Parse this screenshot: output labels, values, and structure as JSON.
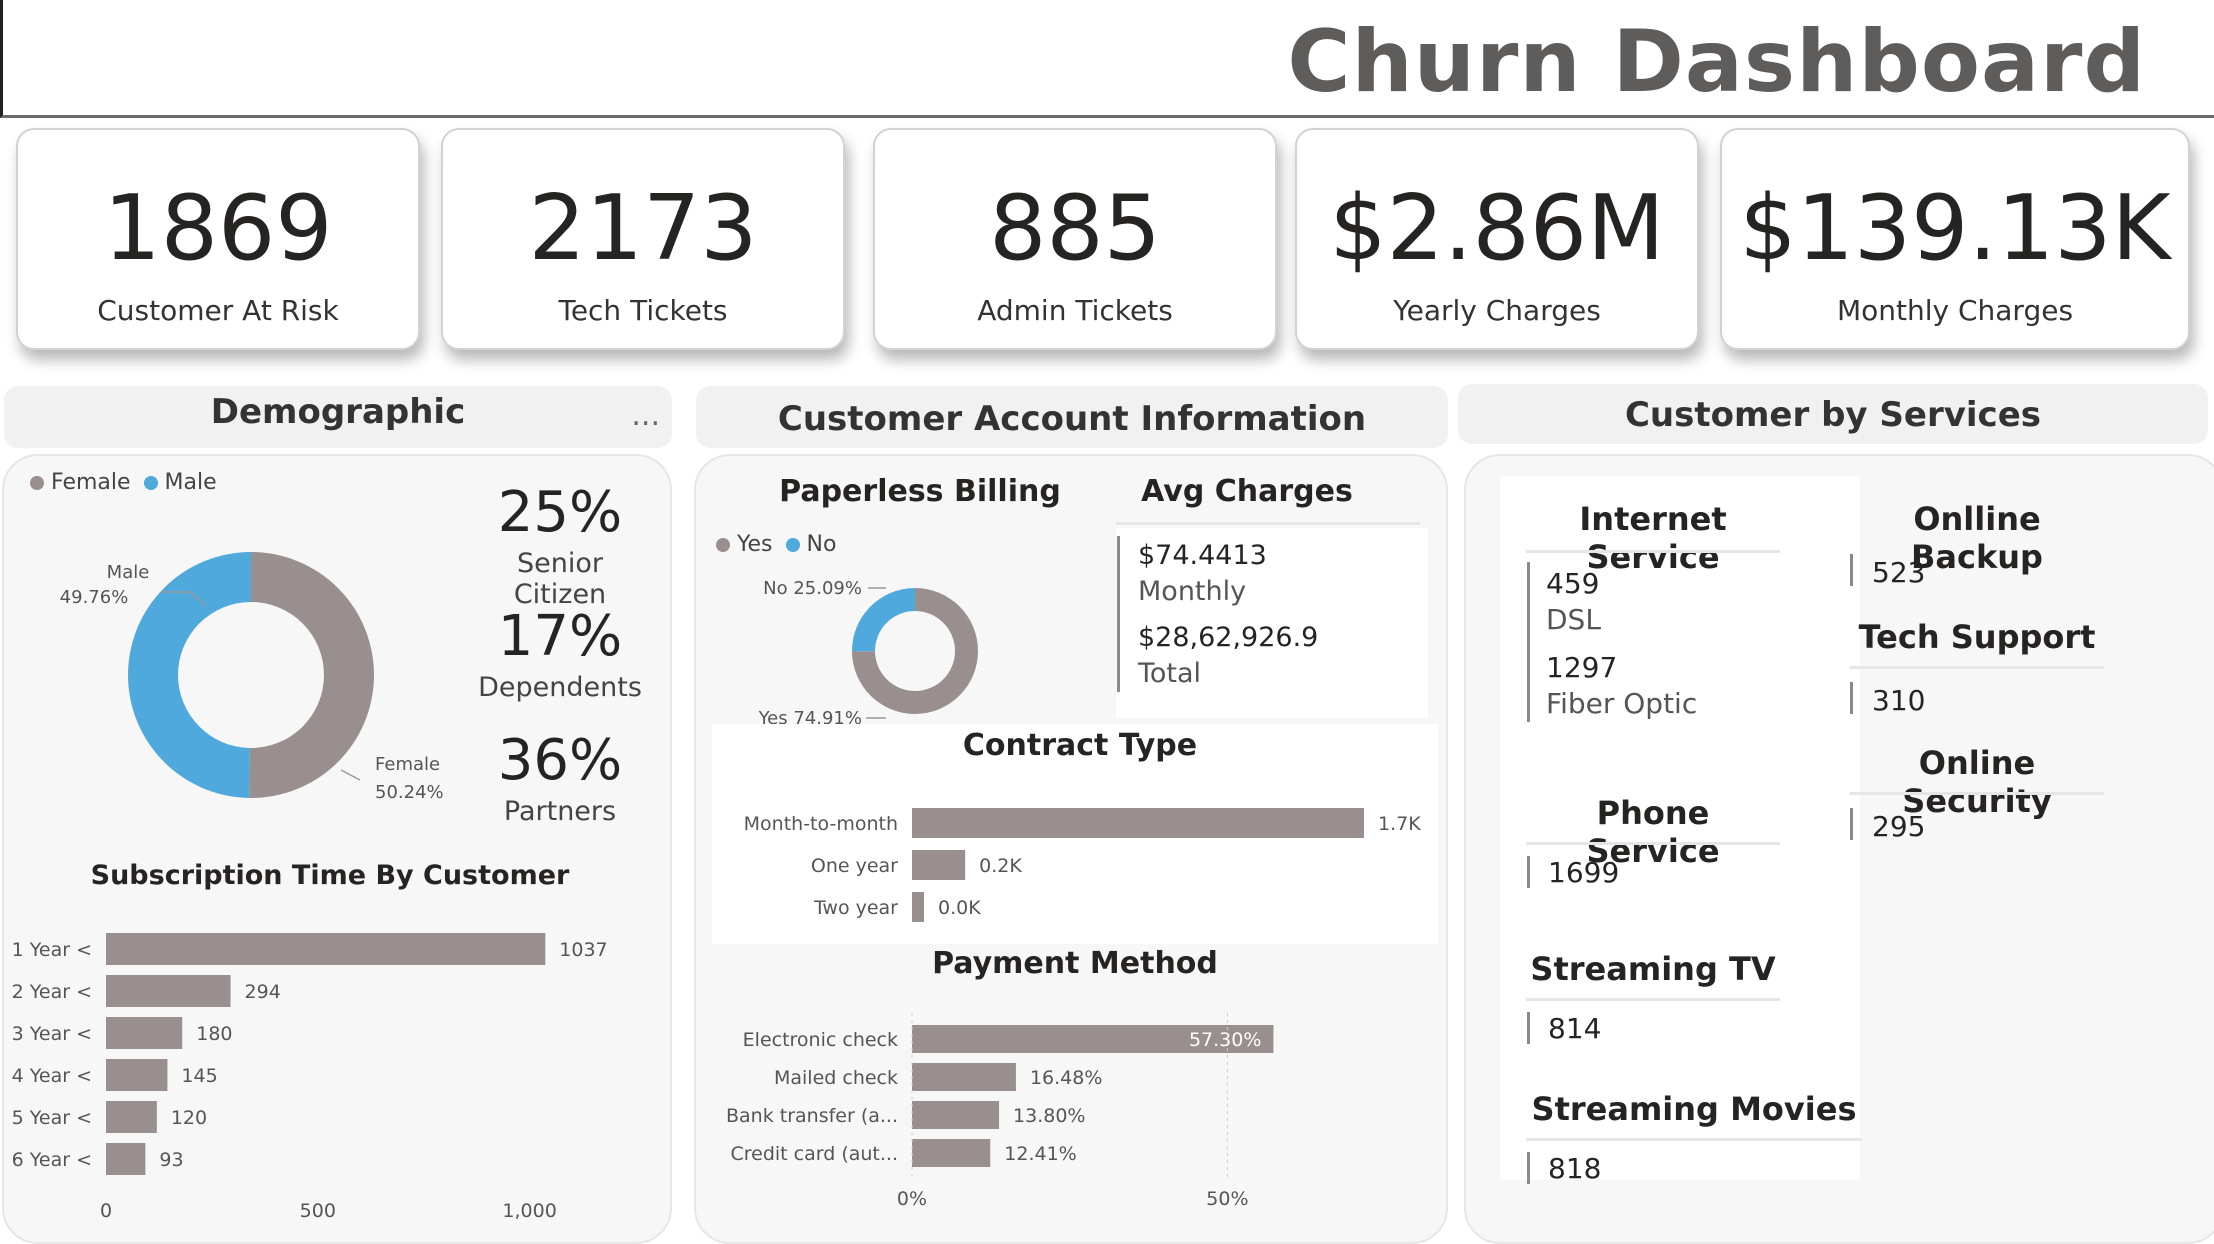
{
  "header": {
    "title": "Churn Dashboard"
  },
  "kpis": [
    {
      "value": "1869",
      "label": "Customer At Risk"
    },
    {
      "value": "2173",
      "label": "Tech Tickets"
    },
    {
      "value": "885",
      "label": "Admin Tickets"
    },
    {
      "value": "$2.86M",
      "label": "Yearly Charges"
    },
    {
      "value": "$139.13K",
      "label": "Monthly Charges"
    }
  ],
  "demographic": {
    "title": "Demographic",
    "more": "...",
    "legend": {
      "female": "Female",
      "male": "Male"
    },
    "donut": {
      "male_name": "Male",
      "male_pct": "49.76%",
      "female_name": "Female",
      "female_pct": "50.24%"
    },
    "stats": [
      {
        "value": "25%",
        "label": "Senior Citizen"
      },
      {
        "value": "17%",
        "label": "Dependents"
      },
      {
        "value": "36%",
        "label": "Partners"
      }
    ],
    "subscription_title": "Subscription Time By Customer"
  },
  "account": {
    "title": "Customer Account Information",
    "paperless_title": "Paperless Billing",
    "paperless_legend": {
      "yes": "Yes",
      "no": "No"
    },
    "paperless_no": "No 25.09%",
    "paperless_yes": "Yes 74.91%",
    "avg_title": "Avg Charges",
    "avg_monthly_value": "$74.4413",
    "avg_monthly_label": "Monthly",
    "avg_total_value": "$28,62,926.9",
    "avg_total_label": "Total",
    "contract_title": "Contract Type",
    "payment_title": "Payment Method"
  },
  "services": {
    "title": "Customer by Services",
    "internet_title": "Internet Service",
    "dsl_value": "459",
    "dsl_label": "DSL",
    "fiber_value": "1297",
    "fiber_label": "Fiber Optic",
    "phone_title": "Phone Service",
    "phone_value": "1699",
    "streamtv_title": "Streaming TV",
    "streamtv_value": "814",
    "streammovies_title": "Streaming Movies",
    "streammovies_value": "818",
    "backup_title": "Onlline Backup",
    "backup_value": "523",
    "techsupport_title": "Tech Support",
    "techsupport_value": "310",
    "security_title": "Online Security",
    "security_value": "295"
  },
  "colors": {
    "gray": "#9a8f8f",
    "blue": "#4fa9dc"
  },
  "chart_data": [
    {
      "type": "pie",
      "title": "",
      "categories": [
        "Female",
        "Male"
      ],
      "values": [
        50.24,
        49.76
      ],
      "colors": [
        "#9a8f8f",
        "#4fa9dc"
      ],
      "legend": "top-left"
    },
    {
      "type": "bar",
      "title": "Subscription Time By Customer",
      "orientation": "horizontal",
      "categories": [
        "1 Year <",
        "2 Year <",
        "3 Year <",
        "4 Year <",
        "5 Year <",
        "6 Year <"
      ],
      "values": [
        1037,
        294,
        180,
        145,
        120,
        93
      ],
      "labels": [
        "1037",
        "294",
        "180",
        "145",
        "120",
        "93"
      ],
      "xlim": [
        0,
        1100
      ],
      "xticks": [
        0,
        500,
        1000
      ],
      "xtick_labels": [
        "0",
        "500",
        "1,000"
      ]
    },
    {
      "type": "pie",
      "title": "Paperless Billing",
      "categories": [
        "Yes",
        "No"
      ],
      "values": [
        74.91,
        25.09
      ],
      "colors": [
        "#9a8f8f",
        "#4fa9dc"
      ],
      "legend": "top-left"
    },
    {
      "type": "bar",
      "title": "Contract Type",
      "orientation": "horizontal",
      "categories": [
        "Month-to-month",
        "One year",
        "Two year"
      ],
      "values": [
        1.7,
        0.2,
        0.04
      ],
      "labels": [
        "1.7K",
        "0.2K",
        "0.0K"
      ]
    },
    {
      "type": "bar",
      "title": "Payment Method",
      "orientation": "horizontal",
      "categories": [
        "Electronic check",
        "Mailed check",
        "Bank transfer (a...",
        "Credit card (aut..."
      ],
      "values": [
        57.3,
        16.48,
        13.8,
        12.41
      ],
      "labels": [
        "57.30%",
        "16.48%",
        "13.80%",
        "12.41%"
      ],
      "xlim": [
        0,
        65
      ],
      "xticks": [
        0,
        50
      ],
      "xtick_labels": [
        "0%",
        "50%"
      ]
    }
  ]
}
